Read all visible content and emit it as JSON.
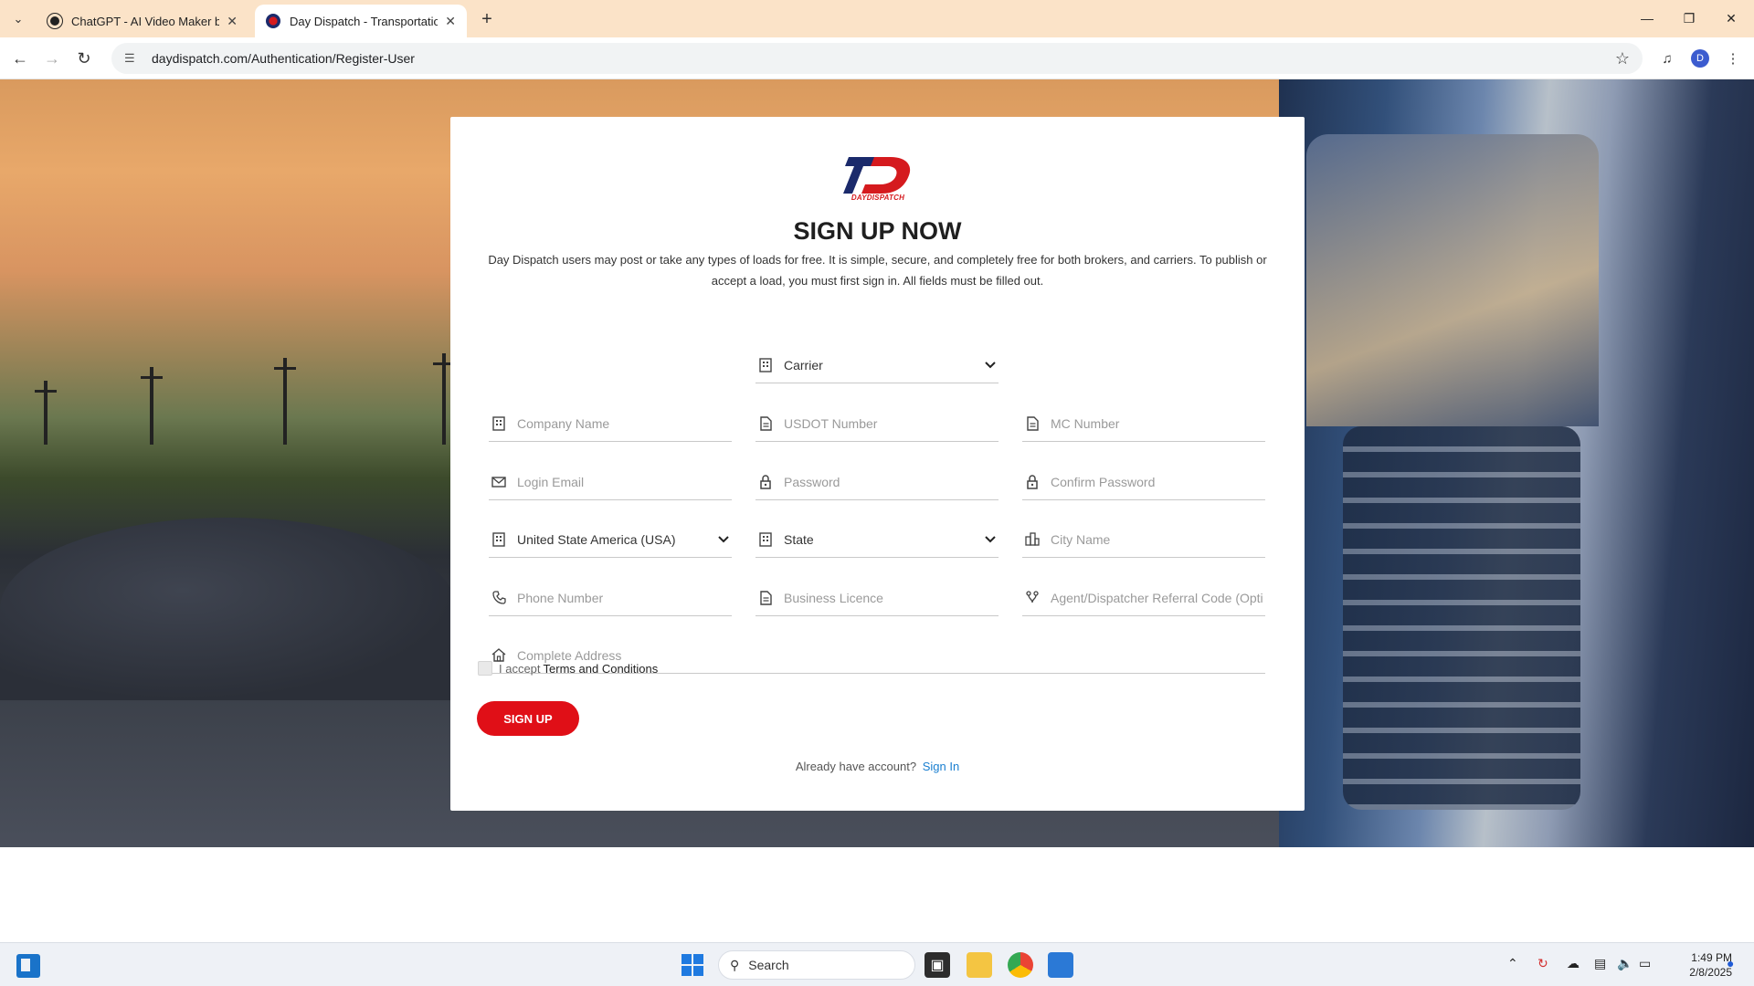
{
  "browser": {
    "tabs": [
      {
        "title": "ChatGPT - AI Video Maker by D",
        "active": false
      },
      {
        "title": "Day Dispatch - Transportation |",
        "active": true
      }
    ],
    "url": "daydispatch.com/Authentication/Register-User",
    "profile_initial": "D"
  },
  "form": {
    "logo_text": "DAYDISPATCH",
    "heading": "SIGN UP NOW",
    "description": "Day Dispatch users may post or take any types of loads for free. It is simple, secure, and completely free for both brokers, and carriers. To publish or accept a load, you must first sign in. All fields must be filled out.",
    "account_type": "Carrier",
    "placeholders": {
      "company_name": "Company Name",
      "usdot_number": "USDOT Number",
      "mc_number": "MC Number",
      "login_email": "Login Email",
      "password": "Password",
      "confirm_password": "Confirm Password",
      "city_name": "City Name",
      "phone_number": "Phone Number",
      "business_licence": "Business Licence",
      "referral_code": "Agent/Dispatcher Referral Code (Optional)",
      "address": "Complete Address"
    },
    "country": "United State America (USA)",
    "state": "State",
    "terms_prefix": "I accept",
    "terms_link": "Terms and Conditions",
    "signup_label": "SIGN UP",
    "already_text": "Already have account?",
    "signin_link": "Sign In"
  },
  "taskbar": {
    "search_label": "Search",
    "time": "1:49 PM",
    "date": "2/8/2025"
  },
  "colors": {
    "brand_red": "#e00f17",
    "link_blue": "#1a7fd0",
    "tab_bar": "#fbe3c8"
  }
}
